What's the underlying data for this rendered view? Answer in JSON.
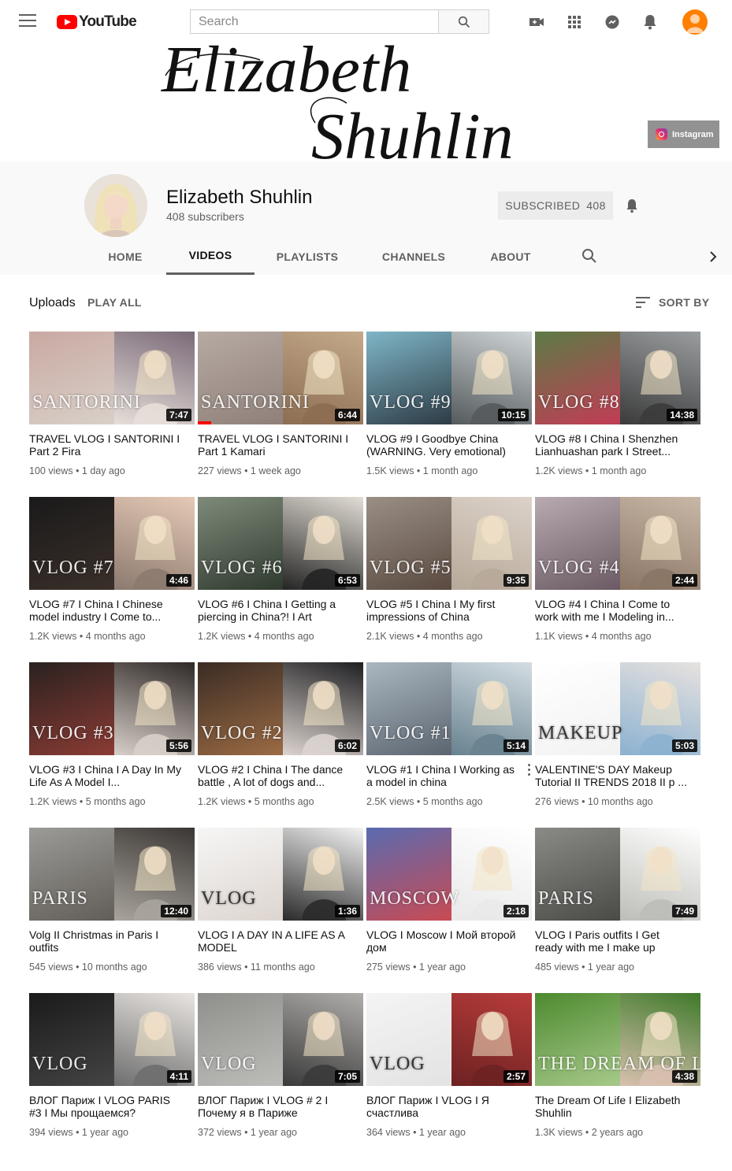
{
  "header": {
    "logo_text": "YouTube",
    "search_placeholder": "Search"
  },
  "banner": {
    "line1": "Elizabeth",
    "line2": "Shuhlin",
    "instagram_label": "Instagram"
  },
  "channel": {
    "name": "Elizabeth Shuhlin",
    "subscribers": "408 subscribers",
    "subscribe_label": "SUBSCRIBED",
    "subscribe_count": "408",
    "tabs": [
      "HOME",
      "VIDEOS",
      "PLAYLISTS",
      "CHANNELS",
      "ABOUT"
    ],
    "active_tab": "VIDEOS"
  },
  "uploads": {
    "title": "Uploads",
    "play_all": "PLAY ALL",
    "sort_by": "SORT BY"
  },
  "videos": [
    {
      "title": "TRAVEL VLOG I SANTORINI I Part 2 Fira",
      "views": "100 views",
      "age": "1 day ago",
      "duration": "7:47",
      "label": "SANTORINI",
      "c1": "#c9a9a2",
      "c2": "#d8d0c8",
      "c3": "#7a6a78",
      "c4": "#e7dfd9"
    },
    {
      "title": "TRAVEL VLOG I SANTORINI I Part 1 Kamari",
      "views": "227 views",
      "age": "1 week ago",
      "duration": "6:44",
      "label": "SANTORINI",
      "c1": "#b7aaa2",
      "c2": "#8f8179",
      "c3": "#c4a98a",
      "c4": "#8c6d52",
      "progress": 0.08
    },
    {
      "title": "VLOG #9 I Goodbye China (WARNING. Very emotional)",
      "views": "1.5K views",
      "age": "1 month ago",
      "duration": "10:15",
      "label": "VLOG #9",
      "c1": "#7fb6c7",
      "c2": "#2d3b45",
      "c3": "#cfd5d6",
      "c4": "#555a5c"
    },
    {
      "title": "VLOG #8 I China I Shenzhen Lianhuashan park I Street...",
      "views": "1.2K views",
      "age": "1 month ago",
      "duration": "14:38",
      "label": "VLOG #8",
      "c1": "#5c7b46",
      "c2": "#c23c55",
      "c3": "#9a9d9f",
      "c4": "#3b3b3b"
    },
    {
      "title": "VLOG #7 I China I Chinese model industry I Come to...",
      "views": "1.2K views",
      "age": "4 months ago",
      "duration": "4:46",
      "label": "VLOG #7",
      "c1": "#1a1a1a",
      "c2": "#3a2f2a",
      "c3": "#e5c9b6",
      "c4": "#8c7a6f"
    },
    {
      "title": "VLOG #6 I China I Getting a piercing in China?! I Art",
      "views": "1.2K views",
      "age": "4 months ago",
      "duration": "6:53",
      "label": "VLOG #6",
      "c1": "#7e8a79",
      "c2": "#2f3a2f",
      "c3": "#e2ddd5",
      "c4": "#242424"
    },
    {
      "title": "VLOG #5 I China I My first impressions of China",
      "views": "2.1K views",
      "age": "4 months ago",
      "duration": "9:35",
      "label": "VLOG #5",
      "c1": "#9a8f85",
      "c2": "#5a4a40",
      "c3": "#dcd2c9",
      "c4": "#b7a999"
    },
    {
      "title": "VLOG #4 I China I Come to work with me I Modeling in...",
      "views": "1.1K views",
      "age": "4 months ago",
      "duration": "2:44",
      "label": "VLOG #4",
      "c1": "#b7aab0",
      "c2": "#6b5a63",
      "c3": "#c9b8a7",
      "c4": "#8a7565"
    },
    {
      "title": "VLOG #3 I China I A Day In My Life As A Model I...",
      "views": "1.2K views",
      "age": "5 months ago",
      "duration": "5:56",
      "label": "VLOG #3",
      "c1": "#2a2220",
      "c2": "#8b3b34",
      "c3": "#2f2927",
      "c4": "#d8cfc9"
    },
    {
      "title": "VLOG #2 I China I The dance battle , A lot of dogs and...",
      "views": "1.2K views",
      "age": "5 months ago",
      "duration": "6:02",
      "label": "VLOG #2",
      "c1": "#3b2c24",
      "c2": "#9b6b44",
      "c3": "#1f1f22",
      "c4": "#dcd4cf"
    },
    {
      "title": "VLOG #1 I China I Working as a model in china",
      "views": "2.5K views",
      "age": "5 months ago",
      "duration": "5:14",
      "label": "VLOG #1",
      "c1": "#aab6c0",
      "c2": "#5b6570",
      "c3": "#d4dde3",
      "c4": "#68828f",
      "kebab": true
    },
    {
      "title": "VALENTINE'S DAY Makeup Tutorial II TRENDS 2018 II p ...",
      "views": "276 views",
      "age": "10 months ago",
      "duration": "5:03",
      "label": "MAKEUP",
      "c1": "#ffffff",
      "c2": "#f2f2f2",
      "c3": "#e7e2df",
      "c4": "#8cb1d0"
    },
    {
      "title": "Volg II Christmas in Paris I outfits",
      "views": "545 views",
      "age": "10 months ago",
      "duration": "12:40",
      "label": "PARIS",
      "c1": "#9b9b98",
      "c2": "#625d57",
      "c3": "#3a3633",
      "c4": "#a9a49d"
    },
    {
      "title": "VLOG I A DAY IN A LIFE AS A MODEL",
      "views": "386 views",
      "age": "11 months ago",
      "duration": "1:36",
      "label": "VLOG",
      "c1": "#f6f6f6",
      "c2": "#ddd5cf",
      "c3": "#f3f3f3",
      "c4": "#2a2a2a"
    },
    {
      "title": "VLOG I Moscow I Мой второй дом",
      "views": "275 views",
      "age": "1 year ago",
      "duration": "2:18",
      "label": "MOSCOW",
      "c1": "#5a6bb0",
      "c2": "#c94a53",
      "c3": "#ffffff",
      "c4": "#e9e9e9"
    },
    {
      "title": "VLOG I Paris outfits I Get ready with me I make up",
      "views": "485 views",
      "age": "1 year ago",
      "duration": "7:49",
      "label": "PARIS",
      "c1": "#8a8a86",
      "c2": "#4a4a46",
      "c3": "#ffffff",
      "c4": "#bdbdb8"
    },
    {
      "title": "ВЛОГ Париж I VLOG PARIS #3 I Мы прощаемся?",
      "views": "394 views",
      "age": "1 year ago",
      "duration": "4:11",
      "label": "VLOG",
      "c1": "#1a1a1a",
      "c2": "#444",
      "c3": "#e9e5e2",
      "c4": "#6e6e6e"
    },
    {
      "title": "ВЛОГ Париж I VLOG # 2 I Почему я в Париже",
      "views": "372 views",
      "age": "1 year ago",
      "duration": "7:05",
      "label": "VLOG",
      "c1": "#8f8f8c",
      "c2": "#bdbdba",
      "c3": "#b0aeab",
      "c4": "#3a3a3a"
    },
    {
      "title": "ВЛОГ Париж I VLOG I Я счастлива",
      "views": "364 views",
      "age": "1 year ago",
      "duration": "2:57",
      "label": "VLOG",
      "c1": "#f4f4f4",
      "c2": "#e3e3e3",
      "c3": "#b83c3a",
      "c4": "#6d2222"
    },
    {
      "title": "The Dream Of Life I Elizabeth Shuhlin",
      "views": "1.3K views",
      "age": "2 years ago",
      "duration": "4:38",
      "label": "THE DREAM OF LIFE",
      "c1": "#4d8a2f",
      "c2": "#a7c98a",
      "c3": "#3f7a2a",
      "c4": "#d9c0b0"
    }
  ]
}
